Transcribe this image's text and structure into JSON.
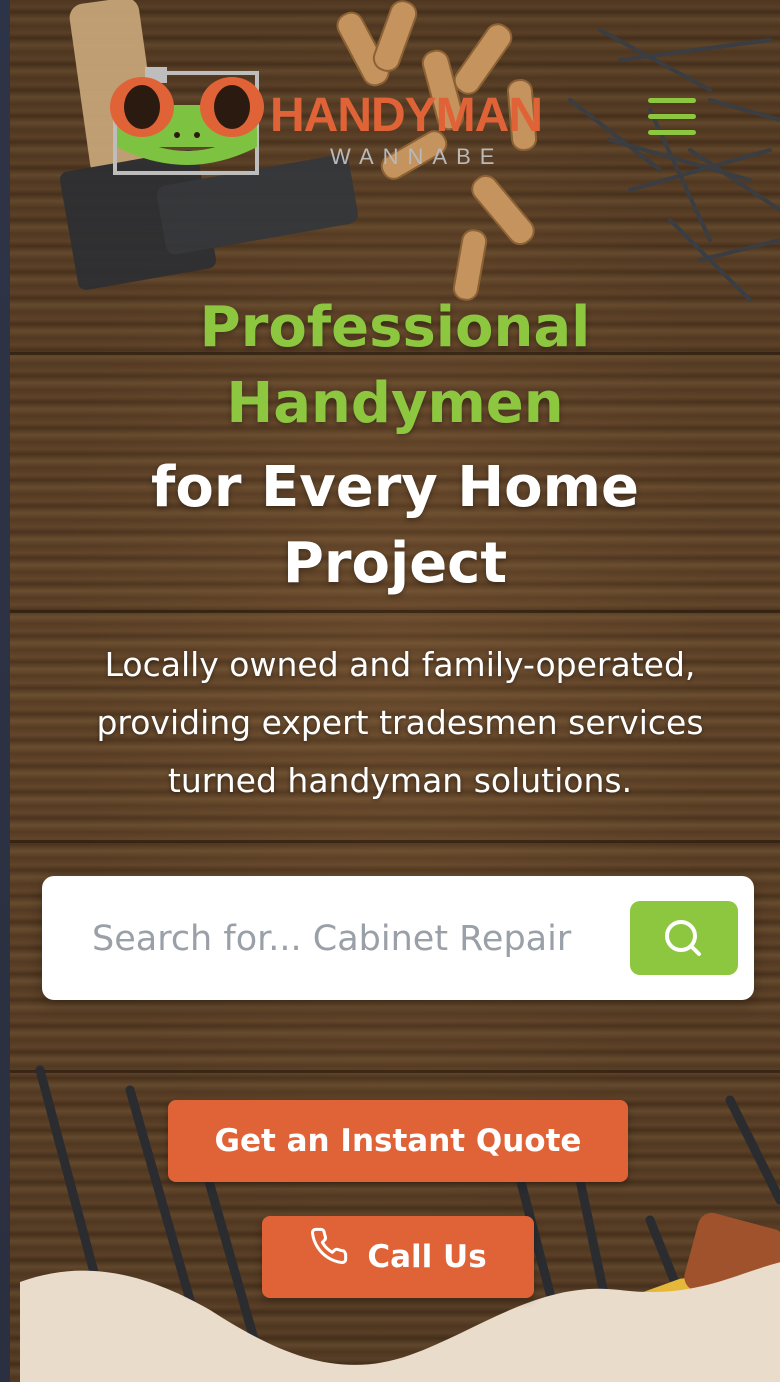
{
  "header": {
    "logo": {
      "brand": "HANDYMAN",
      "tagline": "WANNABE"
    },
    "menu_icon": "hamburger-menu-icon"
  },
  "hero": {
    "headline_highlight": "Professional Handymen",
    "headline_rest": "for Every Home Project",
    "description": "Locally owned and family-operated, providing expert tradesmen services turned handyman solutions."
  },
  "search": {
    "placeholder": "Search for... Cabinet Repair",
    "value": "",
    "icon": "search-icon"
  },
  "actions": {
    "quote_label": "Get an Instant Quote",
    "call_label": "Call Us",
    "call_icon": "phone-icon"
  },
  "colors": {
    "accent_green": "#8dc63f",
    "accent_orange": "#e06338",
    "wave_fill": "#eadccb"
  }
}
